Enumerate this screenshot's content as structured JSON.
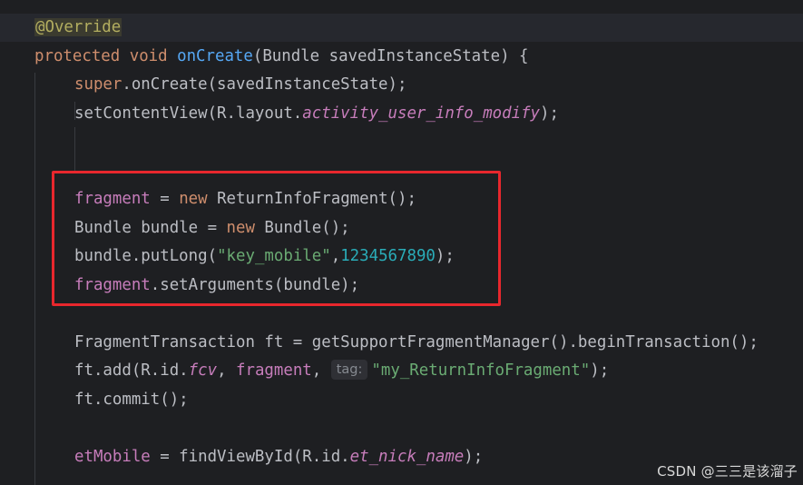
{
  "editor": {
    "language": "Java",
    "current_line": 1,
    "colors": {
      "background": "#1e1f22",
      "keyword": "#cf8e6d",
      "method": "#56a8f5",
      "field": "#c77dbb",
      "string": "#6aab73",
      "number": "#2aacb8",
      "annotation": "#b3ae60",
      "highlight_box": "#e8272d"
    },
    "gutter_icon": "lightbulb-icon",
    "lines": [
      {
        "annotation": "@Override"
      },
      {
        "kw": "protected",
        "kw2": "void",
        "method": "onCreate",
        "rest": "(Bundle savedInstanceState) {"
      },
      {
        "kw": "super",
        "dot_method": ".onCreate(savedInstanceState);"
      },
      {
        "plain": "setContentView(R.layout.",
        "static_field": "activity_user_info_modify",
        "tail": ");"
      },
      {},
      {
        "field": "fragment",
        "mid": " = ",
        "kw": "new",
        "rest": " ReturnInfoFragment();"
      },
      {
        "plain": "Bundle bundle = ",
        "kw": "new",
        "rest": " Bundle();"
      },
      {
        "plain": "bundle.putLong(",
        "str": "\"key_mobile\"",
        "comma": ",",
        "num": "1234567890",
        "tail": ");"
      },
      {
        "field": "fragment",
        "rest": ".setArguments(bundle);"
      },
      {},
      {
        "plain": "FragmentTransaction ft = getSupportFragmentManager().beginTransaction();"
      },
      {
        "plain": "ft.add(R.id.",
        "static_field": "fcv",
        "comma": ", ",
        "field": "fragment",
        "comma2": ", ",
        "hint": "tag:",
        "str": "\"my_ReturnInfoFragment\"",
        "tail": ");"
      },
      {
        "plain": "ft.commit();"
      },
      {},
      {
        "field": "etMobile",
        "mid": " = findViewById(R.id.",
        "static_field": "et_nick_name",
        "tail": ");"
      }
    ]
  },
  "watermark": "CSDN @三三是该溜子"
}
